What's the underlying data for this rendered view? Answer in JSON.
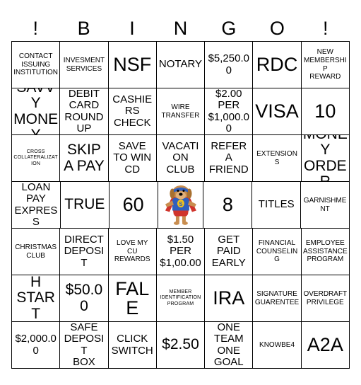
{
  "header": {
    "letters": [
      "!",
      "B",
      "I",
      "N",
      "G",
      "O",
      "!"
    ]
  },
  "grid": {
    "columns": 7,
    "rows": 7,
    "cells": [
      [
        {
          "text": "CONTACT\nISSUING\nINSTITUTION",
          "size": "sm"
        },
        {
          "text": "INVESMENT\nSERVICES",
          "size": "sm"
        },
        {
          "text": "NSF",
          "size": "xl"
        },
        {
          "text": "NOTARY",
          "size": "md"
        },
        {
          "text": "$5,250.00",
          "size": "md"
        },
        {
          "text": "RDC",
          "size": "xl"
        },
        {
          "text": "NEW\nMEMBERSHIP\nREWARD",
          "size": "sm"
        }
      ],
      [
        {
          "text": "SAVVY\nMONEY",
          "size": "lg"
        },
        {
          "text": "DEBIT\nCARD\nROUND\nUP",
          "size": "md"
        },
        {
          "text": "CASHIERS\nCHECK",
          "size": "md"
        },
        {
          "text": "WIRE\nTRANSFER",
          "size": "sm"
        },
        {
          "text": "$2.00\nPER\n$1,000.00",
          "size": "md"
        },
        {
          "text": "VISA",
          "size": "xl"
        },
        {
          "text": "10",
          "size": "xl"
        }
      ],
      [
        {
          "text": "CROSS\nCOLLATERALIZATION",
          "size": "xs"
        },
        {
          "text": "SKIP\nA PAY",
          "size": "lg"
        },
        {
          "text": "SAVE\nTO WIN\nCD",
          "size": "md"
        },
        {
          "text": "VACATION\nCLUB",
          "size": "md"
        },
        {
          "text": "REFER\nA\nFRIEND",
          "size": "md"
        },
        {
          "text": "EXTENSIONS",
          "size": "sm"
        },
        {
          "text": "MONEY\nORDER",
          "size": "lg"
        }
      ],
      [
        {
          "text": "LOAN\nPAY\nEXPRESS",
          "size": "md"
        },
        {
          "text": "TRUE",
          "size": "lg"
        },
        {
          "text": "60",
          "size": "xl"
        },
        {
          "text": "",
          "size": "md",
          "icon": "superhero-dog-mascot"
        },
        {
          "text": "8",
          "size": "xl"
        },
        {
          "text": "TITLES",
          "size": "md"
        },
        {
          "text": "GARNISHMENT",
          "size": "sm"
        }
      ],
      [
        {
          "text": "CHRISTMAS\nCLUB",
          "size": "sm"
        },
        {
          "text": "DIRECT\nDEPOSIT",
          "size": "md"
        },
        {
          "text": "LOVE MY\nCU\nREWARDS",
          "size": "sm"
        },
        {
          "text": "$1.50\nPER\n$1,00.00",
          "size": "md"
        },
        {
          "text": "GET\nPAID\nEARLY",
          "size": "md"
        },
        {
          "text": "FINANCIAL\nCOUNSELING",
          "size": "sm"
        },
        {
          "text": "EMPLOYEE\nASSISTANCE\nPROGRAM",
          "size": "sm"
        }
      ],
      [
        {
          "text": "FRESH\nSTART\nDEBIT",
          "size": "lg"
        },
        {
          "text": "$50.00",
          "size": "lg"
        },
        {
          "text": "FALE",
          "size": "xl"
        },
        {
          "text": "MEMBER\nIDENTIFICATION\nPROGRAM",
          "size": "xs"
        },
        {
          "text": "IRA",
          "size": "xl"
        },
        {
          "text": "SIGNATURE\nGUARENTEE",
          "size": "sm"
        },
        {
          "text": "OVERDRAFT\nPRIVILEGE",
          "size": "sm"
        }
      ],
      [
        {
          "text": "$2,000.00",
          "size": "md"
        },
        {
          "text": "SAFE\nDEPOSIT\nBOX",
          "size": "md"
        },
        {
          "text": "CLICK\nSWITCH",
          "size": "md"
        },
        {
          "text": "$2.50",
          "size": "lg"
        },
        {
          "text": "ONE\nTEAM\nONE\nGOAL",
          "size": "md"
        },
        {
          "text": "KNOWBE4",
          "size": "sm"
        },
        {
          "text": "A2A",
          "size": "xl"
        }
      ]
    ]
  },
  "colors": {
    "border": "#000000",
    "background": "#ffffff",
    "text": "#000000",
    "mascot_cape": "#d0342c",
    "mascot_shirt": "#2f5fbe",
    "mascot_emblem": "#f2c11c",
    "mascot_fur": "#c98e50"
  }
}
